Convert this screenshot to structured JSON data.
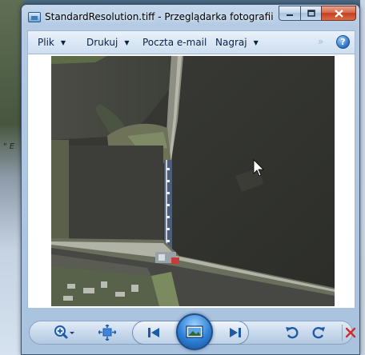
{
  "window": {
    "title": "StandardResolution.tiff - Przeglądarka fotografii sys...",
    "caption_buttons": {
      "minimize": "minimize",
      "maximize": "maximize",
      "close": "close"
    }
  },
  "desktop": {
    "side_text": "\" E"
  },
  "menu": {
    "items": [
      {
        "label": "Plik",
        "has_dropdown": true
      },
      {
        "label": "Drukuj",
        "has_dropdown": true
      },
      {
        "label": "Poczta e-mail",
        "has_dropdown": false
      },
      {
        "label": "Nagraj",
        "has_dropdown": true
      }
    ],
    "overflow": "»",
    "help": "?"
  },
  "image": {
    "content": "aerial-photo-river-lock"
  },
  "toolbar": {
    "buttons": [
      {
        "icon": "zoom-icon"
      },
      {
        "icon": "actual-size-icon"
      },
      {
        "icon": "previous-icon"
      },
      {
        "icon": "slideshow-icon"
      },
      {
        "icon": "next-icon"
      },
      {
        "icon": "rotate-left-icon"
      },
      {
        "icon": "rotate-right-icon"
      },
      {
        "icon": "delete-icon"
      }
    ]
  },
  "colors": {
    "accent_blue": "#2d80d6",
    "delete_red": "#d22b2b",
    "menu_text": "#0b2346"
  }
}
